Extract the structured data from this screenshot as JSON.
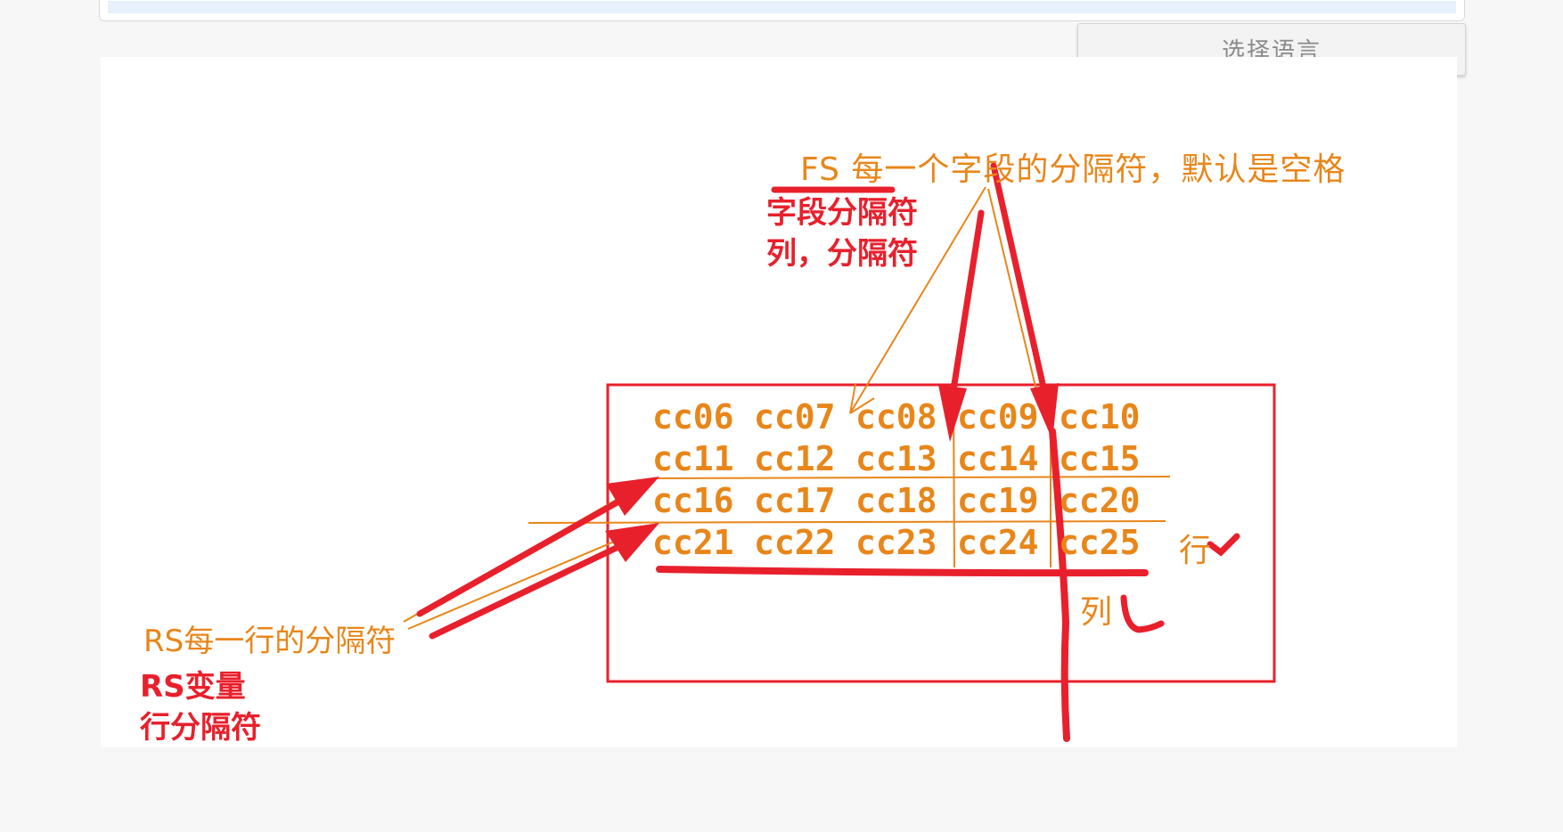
{
  "language_button": {
    "label": "选择语言"
  },
  "diagram": {
    "fs_title": "FS  每一个字段的分隔符，默认是空格",
    "fs_note": [
      "字段分隔符",
      "列，分隔符"
    ],
    "rs_title": "RS每一行的分隔符",
    "rs_note": [
      "RS变量",
      "行分隔符"
    ],
    "row_label": "行",
    "col_label": "列",
    "grid": [
      [
        "cc06",
        "cc07",
        "cc08",
        "cc09",
        "cc10"
      ],
      [
        "cc11",
        "cc12",
        "cc13",
        "cc14",
        "cc15"
      ],
      [
        "cc16",
        "cc17",
        "cc18",
        "cc19",
        "cc20"
      ],
      [
        "cc21",
        "cc22",
        "cc23",
        "cc24",
        "cc25"
      ]
    ],
    "colors": {
      "orange": "#e8861a",
      "red": "#e8202c"
    }
  }
}
